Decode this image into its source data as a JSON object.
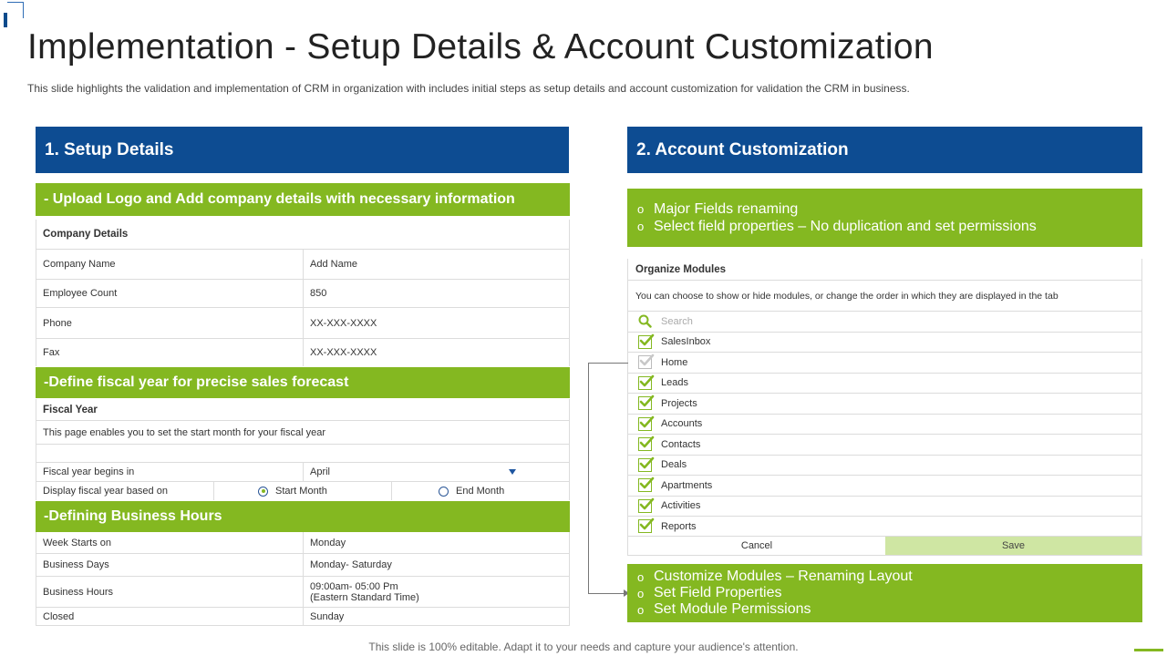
{
  "title": "Implementation - Setup Details & Account Customization",
  "subtitle": "This slide highlights the validation  and implementation of CRM in organization with includes initial steps as setup details and account customization for validation  the CRM in business.",
  "colors": {
    "blue": "#0d4c92",
    "green": "#84b821",
    "light_green": "#cfe6a3"
  },
  "left": {
    "header": "1. Setup Details",
    "section1_title": "- Upload Logo and Add company details with necessary information",
    "company_heading": "Company Details",
    "company_rows": [
      {
        "label": "Company Name",
        "value": "Add Name"
      },
      {
        "label": "Employee  Count",
        "value": "850"
      },
      {
        "label": "Phone",
        "value": "XX-XXX-XXXX"
      },
      {
        "label": "Fax",
        "value": "XX-XXX-XXXX"
      }
    ],
    "section2_title": "-Define fiscal year for precise sales forecast",
    "fiscal_heading": "Fiscal Year",
    "fiscal_note": "This page enables you to set the start month  for your fiscal year",
    "fiscal_begins_label": "Fiscal year begins in",
    "fiscal_begins_value": "April",
    "display_label": "Display  fiscal year based on",
    "radio_start": "Start Month",
    "radio_end": "End Month",
    "section3_title": "-Defining Business  Hours",
    "hours_rows": [
      {
        "label": "Week Starts on",
        "value": "Monday"
      },
      {
        "label": "Business Days",
        "value": "Monday- Saturday"
      },
      {
        "label": "Business Hours",
        "value": "09:00am- 05:00 Pm",
        "value2": "(Eastern Standard Time)"
      },
      {
        "label": "Closed",
        "value": "Sunday"
      }
    ]
  },
  "right": {
    "header": "2. Account Customization",
    "bullets_top": [
      "Major Fields renaming",
      "Select field properties – No duplication and set permissions"
    ],
    "org_heading": "Organize Modules",
    "org_note": "You can choose to show or hide modules, or change the order in  which they are displayed in the tab",
    "search_placeholder": "Search",
    "modules": [
      {
        "label": "SalesInbox",
        "checked": true
      },
      {
        "label": "Home",
        "checked": false
      },
      {
        "label": "Leads",
        "checked": true
      },
      {
        "label": "Projects",
        "checked": true
      },
      {
        "label": "Accounts",
        "checked": true
      },
      {
        "label": "Contacts",
        "checked": true
      },
      {
        "label": "Deals",
        "checked": true
      },
      {
        "label": "Apartments",
        "checked": true
      },
      {
        "label": "Activities",
        "checked": true
      },
      {
        "label": "Reports",
        "checked": true
      }
    ],
    "cancel_label": "Cancel",
    "save_label": "Save",
    "bullets_bottom": [
      "Customize Modules – Renaming Layout",
      "Set Field Properties",
      "Set Module Permissions"
    ],
    "bullet_symbol": "o"
  },
  "footer": "This slide is 100% editable. Adapt it to your needs and capture your audience's attention."
}
